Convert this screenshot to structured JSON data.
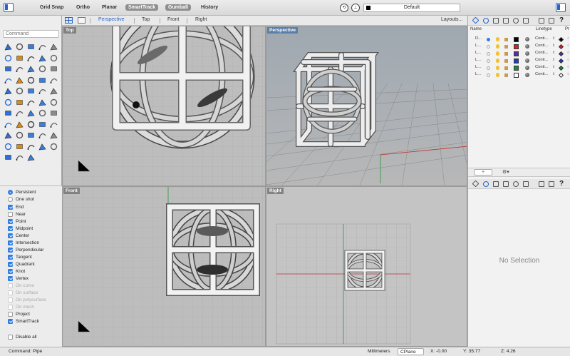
{
  "toolbar": {
    "toggles": [
      "Grid Snap",
      "Ortho",
      "Planar",
      "SmartTrack",
      "Gumball",
      "History"
    ],
    "active_toggles": [
      "SmartTrack",
      "Gumball"
    ],
    "current_layer": "Default",
    "layer_swatch_color": "#000000"
  },
  "command_prompt": {
    "placeholder": "Command"
  },
  "viewport_tabs": {
    "tabs": [
      "Perspective",
      "Top",
      "Front",
      "Right"
    ],
    "active": "Perspective",
    "layouts_label": "Layouts..."
  },
  "viewports": {
    "top": {
      "label": "Top"
    },
    "perspective": {
      "label": "Perspective"
    },
    "front": {
      "label": "Front"
    },
    "right": {
      "label": "Right"
    }
  },
  "osnap": {
    "mode": {
      "persistent": "Persistent",
      "one_shot": "One shot",
      "selected": "Persistent"
    },
    "items": [
      {
        "label": "End",
        "checked": true,
        "enabled": true
      },
      {
        "label": "Near",
        "checked": false,
        "enabled": true
      },
      {
        "label": "Point",
        "checked": true,
        "enabled": true
      },
      {
        "label": "Midpoint",
        "checked": true,
        "enabled": true
      },
      {
        "label": "Center",
        "checked": true,
        "enabled": true
      },
      {
        "label": "Intersection",
        "checked": true,
        "enabled": true
      },
      {
        "label": "Perpendicular",
        "checked": true,
        "enabled": true
      },
      {
        "label": "Tangent",
        "checked": true,
        "enabled": true
      },
      {
        "label": "Quadrant",
        "checked": true,
        "enabled": true
      },
      {
        "label": "Knot",
        "checked": true,
        "enabled": true
      },
      {
        "label": "Vertex",
        "checked": true,
        "enabled": true
      },
      {
        "label": "On curve",
        "checked": false,
        "enabled": false
      },
      {
        "label": "On surface",
        "checked": false,
        "enabled": false
      },
      {
        "label": "On polysurface",
        "checked": false,
        "enabled": false
      },
      {
        "label": "On mesh",
        "checked": false,
        "enabled": false
      },
      {
        "label": "Project",
        "checked": false,
        "enabled": true
      },
      {
        "label": "SmartTrack",
        "checked": true,
        "enabled": true
      }
    ],
    "disable_all": "Disable all"
  },
  "layers_panel": {
    "columns": {
      "name": "Name",
      "linetype": "Linetype",
      "print": "Pr"
    },
    "rows": [
      {
        "name": "D...",
        "current": true,
        "color": "#000000",
        "linetype": "Conti...",
        "print_color": "#000000"
      },
      {
        "name": "L...",
        "current": false,
        "color": "#e02020",
        "linetype": "Conti...",
        "print_color": "#e02020"
      },
      {
        "name": "L...",
        "current": false,
        "color": "#5a2ca8",
        "linetype": "Conti...",
        "print_color": "#5a2ca8"
      },
      {
        "name": "L...",
        "current": false,
        "color": "#1a3ec8",
        "linetype": "Conti...",
        "print_color": "#1a3ec8"
      },
      {
        "name": "L...",
        "current": false,
        "color": "#1b8a2e",
        "linetype": "Conti...",
        "print_color": "#1b8a2e"
      },
      {
        "name": "L...",
        "current": false,
        "color": "#ffffff",
        "linetype": "Conti...",
        "print_color": "#ffffff"
      }
    ]
  },
  "properties_panel": {
    "empty_text": "No Selection"
  },
  "status": {
    "command": "Command: Pipe",
    "units": "Millimeters",
    "cplane": "CPlane",
    "x": "X: -0.00",
    "y": "Y: 35.77",
    "z": "Z: 4.26"
  }
}
